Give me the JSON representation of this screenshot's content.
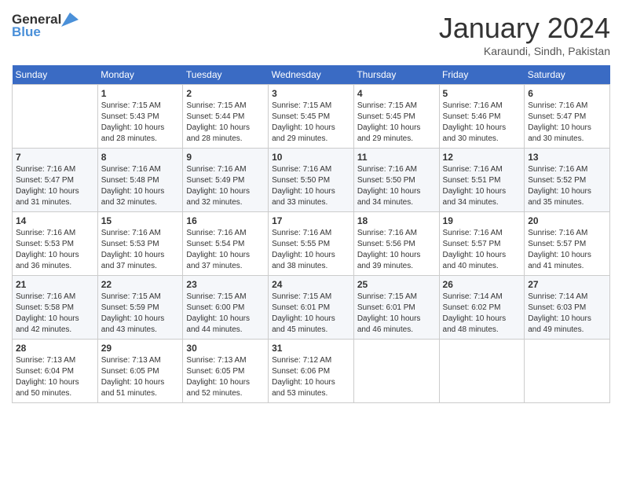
{
  "logo": {
    "line1": "General",
    "line2": "Blue"
  },
  "title": "January 2024",
  "location": "Karaundi, Sindh, Pakistan",
  "weekdays": [
    "Sunday",
    "Monday",
    "Tuesday",
    "Wednesday",
    "Thursday",
    "Friday",
    "Saturday"
  ],
  "weeks": [
    [
      {
        "day": "",
        "info": ""
      },
      {
        "day": "1",
        "info": "Sunrise: 7:15 AM\nSunset: 5:43 PM\nDaylight: 10 hours\nand 28 minutes."
      },
      {
        "day": "2",
        "info": "Sunrise: 7:15 AM\nSunset: 5:44 PM\nDaylight: 10 hours\nand 28 minutes."
      },
      {
        "day": "3",
        "info": "Sunrise: 7:15 AM\nSunset: 5:45 PM\nDaylight: 10 hours\nand 29 minutes."
      },
      {
        "day": "4",
        "info": "Sunrise: 7:15 AM\nSunset: 5:45 PM\nDaylight: 10 hours\nand 29 minutes."
      },
      {
        "day": "5",
        "info": "Sunrise: 7:16 AM\nSunset: 5:46 PM\nDaylight: 10 hours\nand 30 minutes."
      },
      {
        "day": "6",
        "info": "Sunrise: 7:16 AM\nSunset: 5:47 PM\nDaylight: 10 hours\nand 30 minutes."
      }
    ],
    [
      {
        "day": "7",
        "info": "Sunrise: 7:16 AM\nSunset: 5:47 PM\nDaylight: 10 hours\nand 31 minutes."
      },
      {
        "day": "8",
        "info": "Sunrise: 7:16 AM\nSunset: 5:48 PM\nDaylight: 10 hours\nand 32 minutes."
      },
      {
        "day": "9",
        "info": "Sunrise: 7:16 AM\nSunset: 5:49 PM\nDaylight: 10 hours\nand 32 minutes."
      },
      {
        "day": "10",
        "info": "Sunrise: 7:16 AM\nSunset: 5:50 PM\nDaylight: 10 hours\nand 33 minutes."
      },
      {
        "day": "11",
        "info": "Sunrise: 7:16 AM\nSunset: 5:50 PM\nDaylight: 10 hours\nand 34 minutes."
      },
      {
        "day": "12",
        "info": "Sunrise: 7:16 AM\nSunset: 5:51 PM\nDaylight: 10 hours\nand 34 minutes."
      },
      {
        "day": "13",
        "info": "Sunrise: 7:16 AM\nSunset: 5:52 PM\nDaylight: 10 hours\nand 35 minutes."
      }
    ],
    [
      {
        "day": "14",
        "info": "Sunrise: 7:16 AM\nSunset: 5:53 PM\nDaylight: 10 hours\nand 36 minutes."
      },
      {
        "day": "15",
        "info": "Sunrise: 7:16 AM\nSunset: 5:53 PM\nDaylight: 10 hours\nand 37 minutes."
      },
      {
        "day": "16",
        "info": "Sunrise: 7:16 AM\nSunset: 5:54 PM\nDaylight: 10 hours\nand 37 minutes."
      },
      {
        "day": "17",
        "info": "Sunrise: 7:16 AM\nSunset: 5:55 PM\nDaylight: 10 hours\nand 38 minutes."
      },
      {
        "day": "18",
        "info": "Sunrise: 7:16 AM\nSunset: 5:56 PM\nDaylight: 10 hours\nand 39 minutes."
      },
      {
        "day": "19",
        "info": "Sunrise: 7:16 AM\nSunset: 5:57 PM\nDaylight: 10 hours\nand 40 minutes."
      },
      {
        "day": "20",
        "info": "Sunrise: 7:16 AM\nSunset: 5:57 PM\nDaylight: 10 hours\nand 41 minutes."
      }
    ],
    [
      {
        "day": "21",
        "info": "Sunrise: 7:16 AM\nSunset: 5:58 PM\nDaylight: 10 hours\nand 42 minutes."
      },
      {
        "day": "22",
        "info": "Sunrise: 7:15 AM\nSunset: 5:59 PM\nDaylight: 10 hours\nand 43 minutes."
      },
      {
        "day": "23",
        "info": "Sunrise: 7:15 AM\nSunset: 6:00 PM\nDaylight: 10 hours\nand 44 minutes."
      },
      {
        "day": "24",
        "info": "Sunrise: 7:15 AM\nSunset: 6:01 PM\nDaylight: 10 hours\nand 45 minutes."
      },
      {
        "day": "25",
        "info": "Sunrise: 7:15 AM\nSunset: 6:01 PM\nDaylight: 10 hours\nand 46 minutes."
      },
      {
        "day": "26",
        "info": "Sunrise: 7:14 AM\nSunset: 6:02 PM\nDaylight: 10 hours\nand 48 minutes."
      },
      {
        "day": "27",
        "info": "Sunrise: 7:14 AM\nSunset: 6:03 PM\nDaylight: 10 hours\nand 49 minutes."
      }
    ],
    [
      {
        "day": "28",
        "info": "Sunrise: 7:13 AM\nSunset: 6:04 PM\nDaylight: 10 hours\nand 50 minutes."
      },
      {
        "day": "29",
        "info": "Sunrise: 7:13 AM\nSunset: 6:05 PM\nDaylight: 10 hours\nand 51 minutes."
      },
      {
        "day": "30",
        "info": "Sunrise: 7:13 AM\nSunset: 6:05 PM\nDaylight: 10 hours\nand 52 minutes."
      },
      {
        "day": "31",
        "info": "Sunrise: 7:12 AM\nSunset: 6:06 PM\nDaylight: 10 hours\nand 53 minutes."
      },
      {
        "day": "",
        "info": ""
      },
      {
        "day": "",
        "info": ""
      },
      {
        "day": "",
        "info": ""
      }
    ]
  ]
}
